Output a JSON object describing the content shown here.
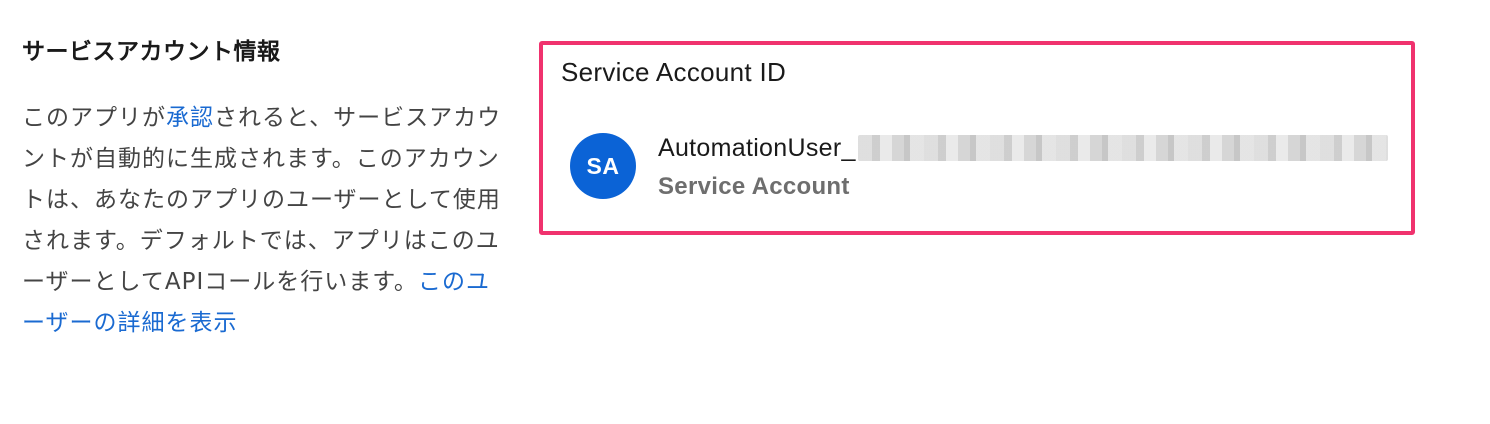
{
  "info_section": {
    "title": "サービスアカウント情報",
    "desc_part1": "このアプリが",
    "approve_link": "承認",
    "desc_part2": "されると、サービスアカウントが自動的に生成されます。このアカウントは、あなたのアプリのユーザーとして使用されます。デフォルトでは、アプリはこのユーザーとしてAPIコールを行います。",
    "details_link": "このユーザーの詳細を表示"
  },
  "service_account_card": {
    "label": "Service Account ID",
    "avatar_initials": "SA",
    "user_name_prefix": "AutomationUser_",
    "user_type": "Service Account",
    "border_color": "#f0326e",
    "avatar_color": "#0b63d6"
  }
}
